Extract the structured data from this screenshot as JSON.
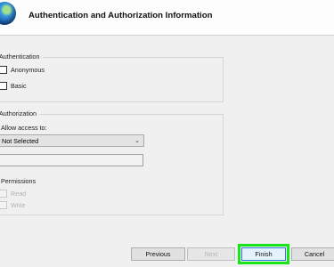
{
  "header": {
    "title": "Authentication and Authorization Information",
    "icon": "globe-icon"
  },
  "authentication": {
    "legend": "Authentication",
    "options": [
      {
        "label": "Anonymous",
        "checked": false
      },
      {
        "label": "Basic",
        "checked": false
      }
    ]
  },
  "authorization": {
    "legend": "Authorization",
    "allow_access_label": "Allow access to:",
    "allow_access_value": "Not Selected",
    "users_input_value": "",
    "permissions": {
      "label": "Permissions",
      "options": [
        {
          "label": "Read",
          "checked": false,
          "enabled": false
        },
        {
          "label": "Write",
          "checked": false,
          "enabled": false
        }
      ]
    }
  },
  "footer": {
    "previous_label": "Previous",
    "next_label": "Next",
    "finish_label": "Finish",
    "cancel_label": "Cancel"
  },
  "colors": {
    "highlight": "#19e619",
    "background": "#f0f0f0"
  }
}
